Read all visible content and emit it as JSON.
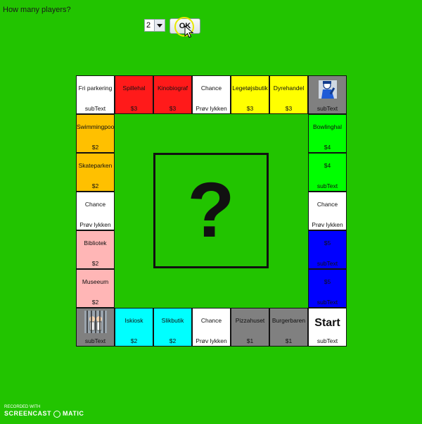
{
  "prompt": "How many players?",
  "player_select": {
    "value": "2"
  },
  "ok_label": "OK",
  "center_symbol": "?",
  "watermark": {
    "line1": "RECORDED WITH",
    "line2a": "SCREENCAST",
    "line2b": "MATIC"
  },
  "colors": {
    "background": "#22c400",
    "red": "#ff1a1a",
    "yellow": "#ffff00",
    "orange": "#ffc000",
    "pink": "#ffb6b6",
    "cyan": "#00ffff",
    "gray": "#808080",
    "blue": "#0000ff",
    "green": "#00ff00",
    "white": "#ffffff"
  },
  "board": {
    "top": [
      {
        "name": "Fri parkering",
        "sub": "subText",
        "color": "#ffffff",
        "kind": "corner"
      },
      {
        "name": "Spillehal",
        "price": "$3",
        "color": "#ff1a1a"
      },
      {
        "name": "Kinobiograf",
        "price": "$3",
        "color": "#ff1a1a"
      },
      {
        "name": "Chance",
        "sub": "Prøv lykken",
        "color": "#ffffff"
      },
      {
        "name": "Legetøjsbutik",
        "price": "$3",
        "color": "#ffff00"
      },
      {
        "name": "Dyrehandel",
        "price": "$3",
        "color": "#ffff00"
      },
      {
        "name": "",
        "sub": "subText",
        "color": "#808080",
        "kind": "police-icon"
      }
    ],
    "left": [
      {
        "name": "Swimmingpool",
        "price": "$2",
        "color": "#ffc000"
      },
      {
        "name": "Skateparken",
        "price": "$2",
        "color": "#ffc000"
      },
      {
        "name": "Chance",
        "sub": "Prøv lykken",
        "color": "#ffffff"
      },
      {
        "name": "Bibliotek",
        "price": "$2",
        "color": "#ffb6b6"
      },
      {
        "name": "Museeum",
        "price": "$2",
        "color": "#ffb6b6"
      }
    ],
    "right": [
      {
        "name": "Bowlinghal",
        "price": "$4",
        "color": "#00ff00"
      },
      {
        "name": "$4",
        "sub": "subText",
        "color": "#00ff00"
      },
      {
        "name": "Chance",
        "sub": "Prøv lykken",
        "color": "#ffffff"
      },
      {
        "name": "$5",
        "sub": "subText",
        "color": "#0000ff"
      },
      {
        "name": "$5",
        "sub": "subText",
        "color": "#0000ff"
      }
    ],
    "bottom": [
      {
        "name": "",
        "sub": "subText",
        "color": "#808080",
        "kind": "jail-icon"
      },
      {
        "name": "Iskiosk",
        "price": "$2",
        "color": "#00ffff"
      },
      {
        "name": "Slikbutik",
        "price": "$2",
        "color": "#00ffff"
      },
      {
        "name": "Chance",
        "sub": "Prøv lykken",
        "color": "#ffffff"
      },
      {
        "name": "Pizzahuset",
        "price": "$1",
        "color": "#808080"
      },
      {
        "name": "Burgerbaren",
        "price": "$1",
        "color": "#808080"
      },
      {
        "name": "Start",
        "sub": "subText",
        "color": "#ffffff",
        "kind": "start"
      }
    ]
  }
}
